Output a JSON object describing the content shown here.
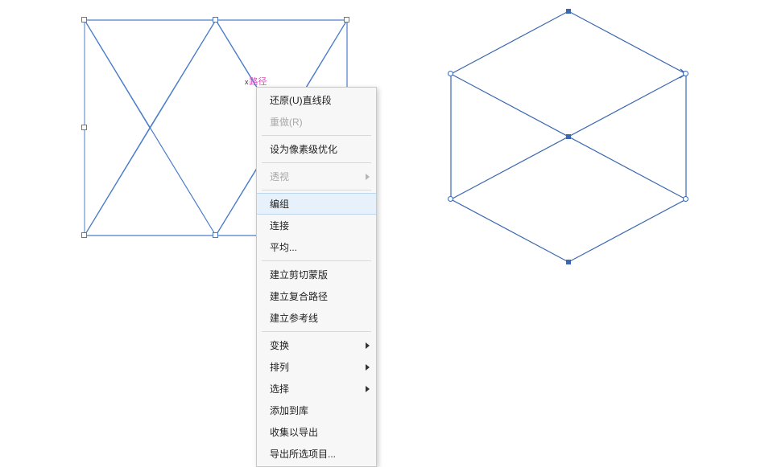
{
  "label": {
    "path": "路径",
    "x": "x"
  },
  "menu": {
    "undo": "还原(U)直线段",
    "redo": "重做(R)",
    "pixelOptimize": "设为像素级优化",
    "perspective": "透视",
    "group": "编组",
    "join": "连接",
    "average": "平均...",
    "clippingMask": "建立剪切蒙版",
    "compoundPath": "建立复合路径",
    "guides": "建立参考线",
    "transform": "变换",
    "arrange": "排列",
    "select": "选择",
    "addToLibrary": "添加到库",
    "collectExport": "收集以导出",
    "exportSelection": "导出所选项目..."
  },
  "colors": {
    "stroke": "#4a7dc9",
    "stroke2": "#3a67b0",
    "label": "#e64fc2"
  }
}
